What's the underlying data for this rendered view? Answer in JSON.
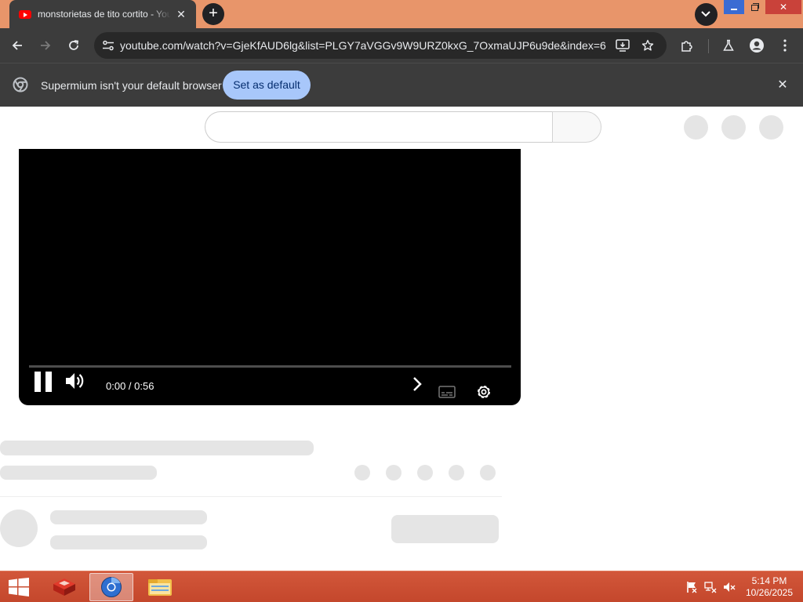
{
  "browser": {
    "tab_title": "monstorietas de tito cortito - YouTube",
    "tab_close": "✕",
    "new_tab": "+",
    "window_close": "✕",
    "url": "youtube.com/watch?v=GjeKfAUD6lg&list=PLGY7aVGGv9W9URZ0kxG_7OxmaUJP6u9de&index=6"
  },
  "infobar": {
    "message": "Supermium isn't your default browser",
    "button_label": "Set as default",
    "close": "✕"
  },
  "player": {
    "time": "0:00 / 0:56",
    "progress_fraction": 0.0,
    "state": "playing"
  },
  "taskbar": {
    "time": "5:14 PM",
    "date": "10/26/2025"
  },
  "colors": {
    "titlebar": "#e8956a",
    "toolbar": "#3c3c3c",
    "set_default_button": "#a8c7fa",
    "taskbar": "#c4472c",
    "placeholder": "#e5e5e5"
  },
  "icons": [
    "youtube-favicon",
    "chevron-down-icon",
    "back-icon",
    "forward-icon",
    "reload-icon",
    "tune-icon",
    "install-icon",
    "star-icon",
    "extensions-icon",
    "labs-icon",
    "profile-icon",
    "more-icon",
    "chrome-icon",
    "pause-icon",
    "volume-icon",
    "next-icon",
    "captions-icon",
    "settings-gear-icon",
    "windows-start-icon",
    "file-explorer-icon"
  ]
}
